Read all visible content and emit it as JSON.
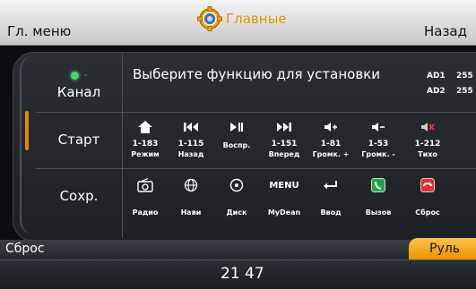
{
  "header": {
    "left": "Гл. меню",
    "title": "Главные",
    "right": "Назад",
    "title_icon": "gear-icon"
  },
  "side": {
    "channel_label": "Канал",
    "channel_dash": "-",
    "start": "Старт",
    "save": "Сохр."
  },
  "prompt": "Выберите функцию для установки",
  "ad": {
    "ad1_label": "AD1",
    "ad1_value": "255",
    "ad2_label": "AD2",
    "ad2_value": "255"
  },
  "row1": [
    {
      "icon": "home-icon",
      "num": "1-183",
      "label": "Режим"
    },
    {
      "icon": "previous-icon",
      "num": "1-115",
      "label": "Назад"
    },
    {
      "icon": "play-pause-icon",
      "num": "",
      "label": "Воспр."
    },
    {
      "icon": "next-icon",
      "num": "1-151",
      "label": "Вперед"
    },
    {
      "icon": "volume-up-icon",
      "num": "1-81",
      "label": "Громк. +"
    },
    {
      "icon": "volume-down-icon",
      "num": "1-53",
      "label": "Громк. -"
    },
    {
      "icon": "mute-icon",
      "num": "1-212",
      "label": "Тихо"
    }
  ],
  "row2": [
    {
      "icon": "radio-icon",
      "icon_text": "",
      "label": "Радио"
    },
    {
      "icon": "globe-icon",
      "icon_text": "",
      "label": "Нави"
    },
    {
      "icon": "disc-icon",
      "icon_text": "",
      "label": "Диск"
    },
    {
      "icon": "menu-icon",
      "icon_text": "MENU",
      "label": "MyDean"
    },
    {
      "icon": "enter-icon",
      "icon_text": "",
      "label": "Ввод"
    },
    {
      "icon": "call-icon",
      "icon_text": "",
      "label": "Вызов"
    },
    {
      "icon": "hangup-icon",
      "icon_text": "",
      "label": "Сброс"
    }
  ],
  "tabs": {
    "left": "Сброс",
    "right": "Руль"
  },
  "clock": "21 47",
  "colors": {
    "accent": "#e38a00",
    "indicator_green": "#4dd26a",
    "call_green": "#22a34a",
    "hangup_red": "#d6333a",
    "mute_red": "#e33"
  }
}
